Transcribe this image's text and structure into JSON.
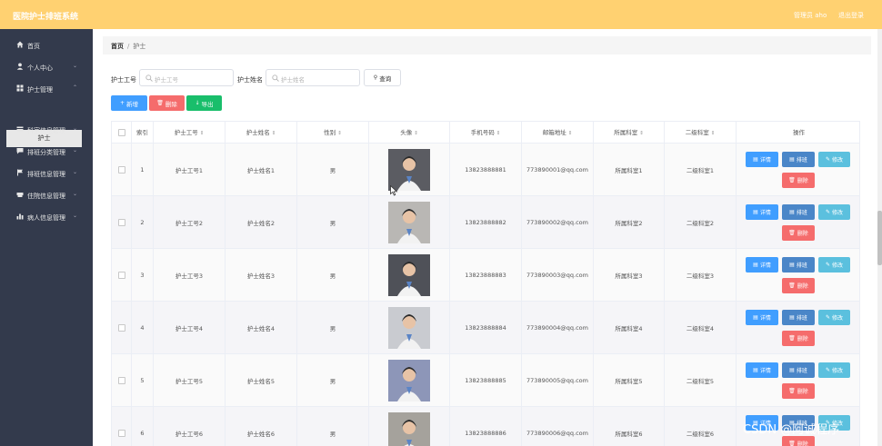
{
  "topbar": {
    "title": "医院护士排班系统",
    "user": "管理员 aho",
    "logout": "退出登录",
    "bg_color": "#ffd171"
  },
  "sidebar": {
    "items": [
      {
        "label": "首页",
        "icon": "home-icon",
        "has_chevron": false
      },
      {
        "label": "个人中心",
        "icon": "user-icon",
        "has_chevron": true
      },
      {
        "label": "护士管理",
        "icon": "grid-icon",
        "has_chevron": true
      },
      {
        "label": "科室信息管理",
        "icon": "card-icon",
        "has_chevron": true
      },
      {
        "label": "排班分类管理",
        "icon": "chat-icon",
        "has_chevron": true
      },
      {
        "label": "排班信息管理",
        "icon": "flag-icon",
        "has_chevron": true
      },
      {
        "label": "住院信息管理",
        "icon": "bed-icon",
        "has_chevron": true
      },
      {
        "label": "病人信息管理",
        "icon": "chart-icon",
        "has_chevron": true
      }
    ],
    "sub_selected": "护士"
  },
  "breadcrumb": {
    "home": "首页",
    "separator": "/",
    "current": "护士"
  },
  "search": {
    "field1_label": "护士工号",
    "field1_placeholder": "护士工号",
    "field2_label": "护士姓名",
    "field2_placeholder": "护士姓名",
    "query_button": "查询"
  },
  "actions": {
    "add": "新增",
    "delete": "删除",
    "export": "导出"
  },
  "table": {
    "headers": [
      "索引",
      "护士工号",
      "护士姓名",
      "性别",
      "头像",
      "手机号码",
      "邮箱地址",
      "所属科室",
      "二级科室",
      "操作"
    ],
    "rows": [
      {
        "index": "1",
        "no": "护士工号1",
        "name": "护士姓名1",
        "gender": "男",
        "phone": "13823888881",
        "email": "773890001@qq.com",
        "dept": "所属科室1",
        "sub_dept": "二级科室1"
      },
      {
        "index": "2",
        "no": "护士工号2",
        "name": "护士姓名2",
        "gender": "男",
        "phone": "13823888882",
        "email": "773890002@qq.com",
        "dept": "所属科室2",
        "sub_dept": "二级科室2"
      },
      {
        "index": "3",
        "no": "护士工号3",
        "name": "护士姓名3",
        "gender": "男",
        "phone": "13823888883",
        "email": "773890003@qq.com",
        "dept": "所属科室3",
        "sub_dept": "二级科室3"
      },
      {
        "index": "4",
        "no": "护士工号4",
        "name": "护士姓名4",
        "gender": "男",
        "phone": "13823888884",
        "email": "773890004@qq.com",
        "dept": "所属科室4",
        "sub_dept": "二级科室4"
      },
      {
        "index": "5",
        "no": "护士工号5",
        "name": "护士姓名5",
        "gender": "男",
        "phone": "13823888885",
        "email": "773890005@qq.com",
        "dept": "所属科室5",
        "sub_dept": "二级科室5"
      },
      {
        "index": "6",
        "no": "护士工号6",
        "name": "护士姓名6",
        "gender": "男",
        "phone": "13823888886",
        "email": "773890006@qq.com",
        "dept": "所属科室6",
        "sub_dept": "二级科室6"
      }
    ],
    "ops": {
      "detail": "详情",
      "shift": "排班",
      "edit": "修改",
      "delete": "删除"
    }
  },
  "watermark": "CSDN @阿诚程序"
}
